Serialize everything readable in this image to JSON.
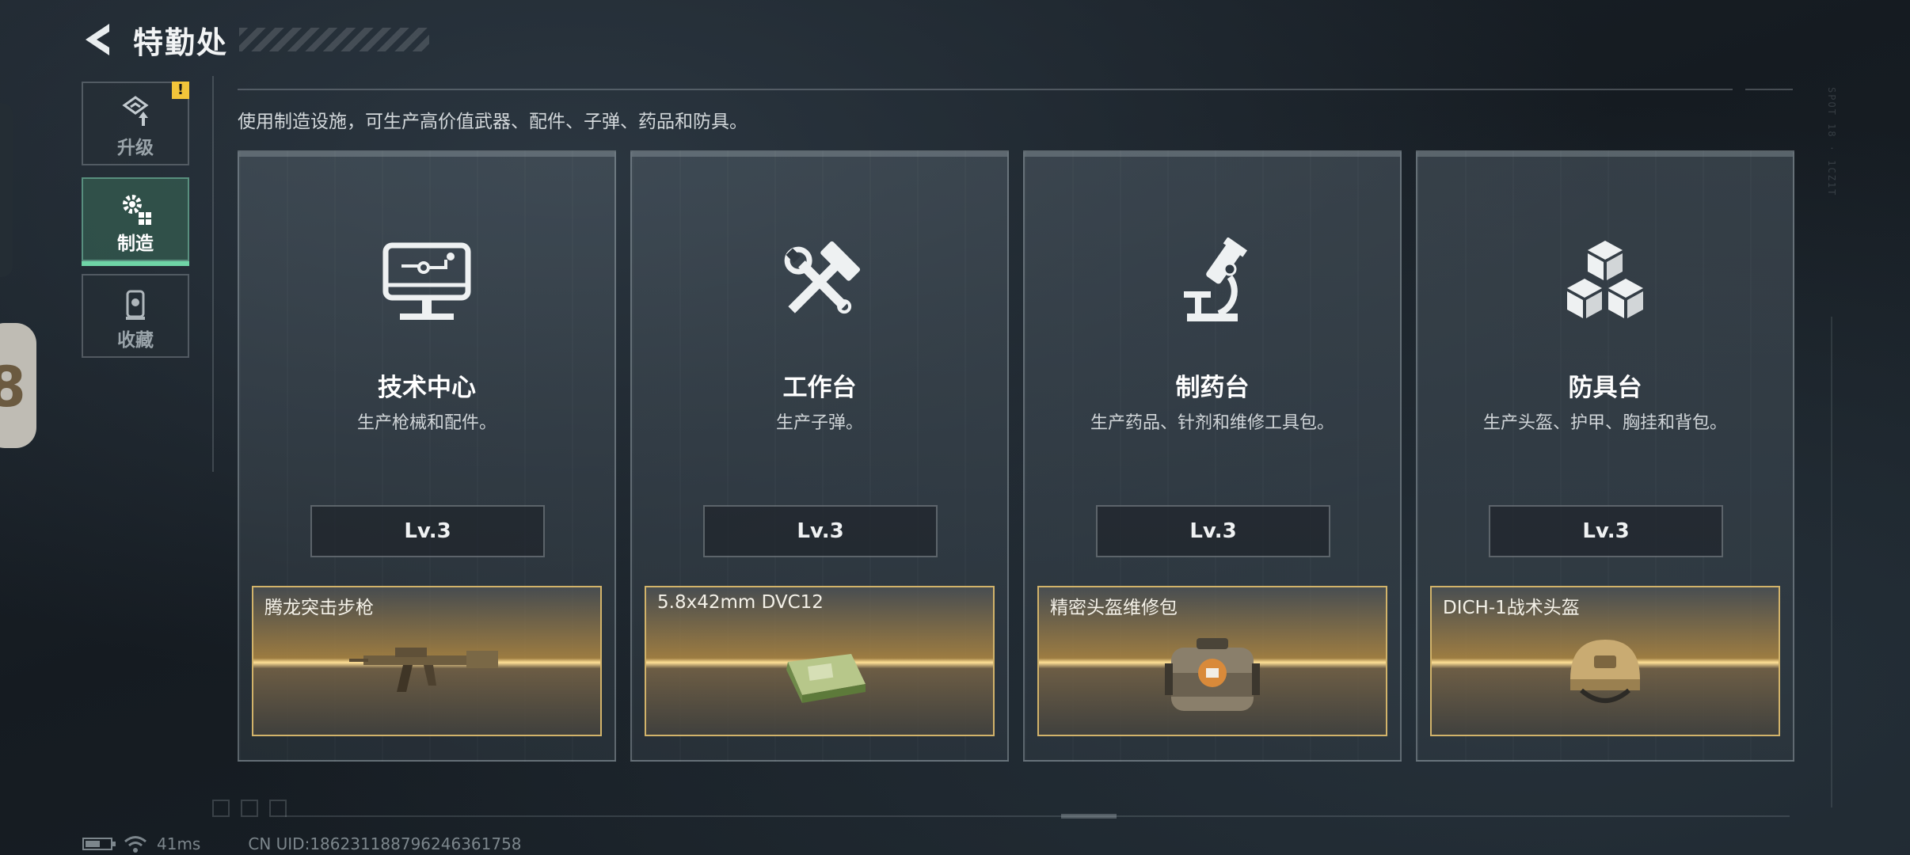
{
  "header": {
    "title": "特勤处"
  },
  "side_tabs": [
    {
      "label": "升级",
      "icon": "upgrade-icon",
      "alert": "!"
    },
    {
      "label": "制造",
      "icon": "gear-icon",
      "active": true
    },
    {
      "label": "收藏",
      "icon": "collection-icon"
    }
  ],
  "description": "使用制造设施，可生产高价值武器、配件、子弹、药品和防具。",
  "cards": [
    {
      "title": "技术中心",
      "desc": "生产枪械和配件。",
      "level": "Lv.3",
      "icon": "computer-icon",
      "product": "腾龙突击步枪"
    },
    {
      "title": "工作台",
      "desc": "生产子弹。",
      "level": "Lv.3",
      "icon": "hammer-wrench-icon",
      "product": "5.8x42mm DVC12"
    },
    {
      "title": "制药台",
      "desc": "生产药品、针剂和维修工具包。",
      "level": "Lv.3",
      "icon": "microscope-icon",
      "product": "精密头盔维修包"
    },
    {
      "title": "防具台",
      "desc": "生产头盔、护甲、胸挂和背包。",
      "level": "Lv.3",
      "icon": "cubes-icon",
      "product": "DICH-1战术头盔"
    }
  ],
  "status_bar": {
    "ping": "41ms",
    "uid": "CN UID:18623118879624636175​8"
  },
  "deco": {
    "vertical_text": "SPOT  18 · 1CZ1T"
  },
  "colors": {
    "accent": "#6fd4a6",
    "product_border": "#d2b36a",
    "alert": "#f3c53a"
  }
}
